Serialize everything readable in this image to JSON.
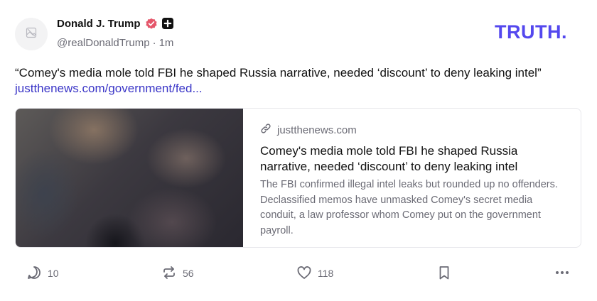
{
  "author": {
    "display_name": "Donald J. Trump",
    "handle": "@realDonaldTrump",
    "separator": "·",
    "time_ago": "1m",
    "verified_icon": "verified-badge-icon",
    "verified_color": "#e5566a"
  },
  "brand": {
    "logo_text": "TRUTH",
    "logo_dot": ".",
    "brand_color": "#5448ee"
  },
  "post": {
    "text": "“Comey's media mole told FBI he shaped Russia narrative, needed ‘discount’ to deny leaking intel”",
    "link_text": "justthenews.com/government/fed...",
    "link_color": "#3a35c7"
  },
  "card": {
    "domain": "justthenews.com",
    "title": "Comey's media mole told FBI he shaped Russia narrative, needed ‘discount’ to deny leaking intel",
    "description": "The FBI confirmed illegal intel leaks but rounded up no offenders. Declassified memos have unmasked Comey's secret media conduit, a law professor whom Comey put on the government payroll."
  },
  "actions": {
    "replies": "10",
    "retruths": "56",
    "likes": "118"
  }
}
